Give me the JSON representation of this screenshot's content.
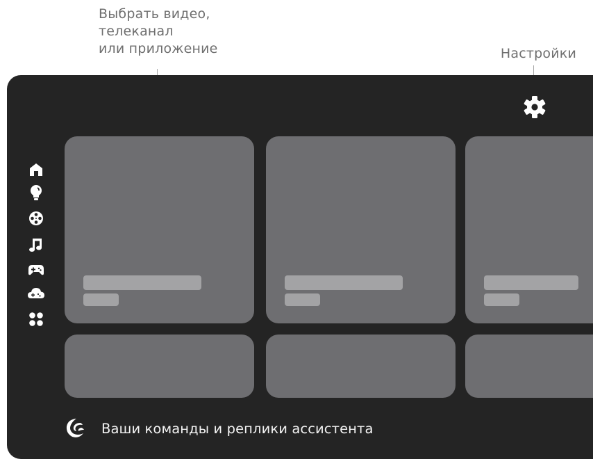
{
  "callouts": {
    "content_lines": [
      "Выбрать видео,",
      "телеканал",
      "или приложение"
    ],
    "settings": "Настройки"
  },
  "icons": {
    "settings": "gear-icon",
    "sidebar": [
      "home-icon",
      "lightbulb-icon",
      "film-reel-icon",
      "music-note-icon",
      "gamepad-icon",
      "cloud-gaming-icon",
      "apps-grid-icon"
    ],
    "assistant": "assistant-swirl-icon"
  },
  "assistant": {
    "text": "Ваши команды и реплики ассистента"
  },
  "cards": {
    "large_count": 3,
    "small_count": 3
  },
  "colors": {
    "callout_text": "#6f6f6f",
    "screen_background": "#242424",
    "card": "#6e6e71",
    "card_placeholder_bar": "#a3a3a5",
    "icon": "#ffffff"
  }
}
